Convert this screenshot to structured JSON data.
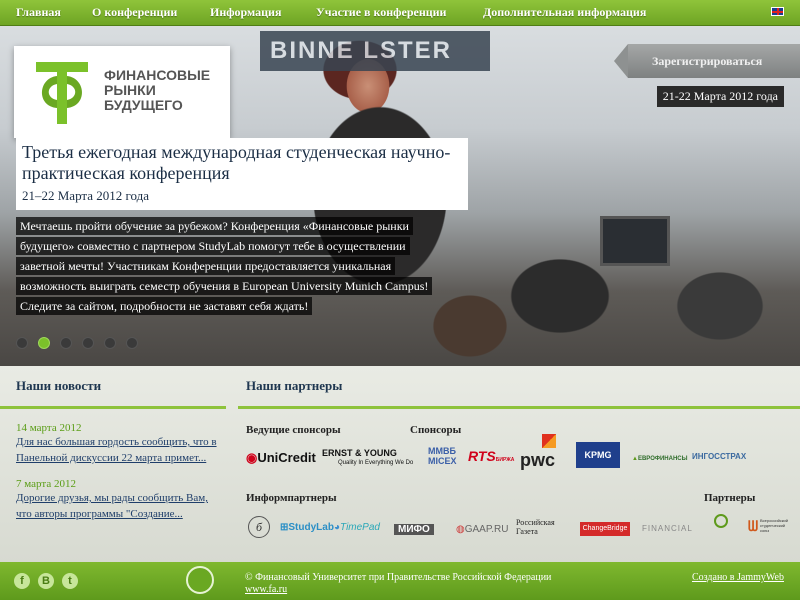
{
  "nav": {
    "items": [
      "Главная",
      "О конференции",
      "Информация",
      "Участие в конференции",
      "Дополнительная информация"
    ],
    "lang_icon": "uk-flag-icon"
  },
  "hero": {
    "sign_text": "BINNE  LSTER",
    "logo_lines": [
      "ФИНАНСОВЫЕ",
      "РЫНКИ",
      "БУДУЩЕГО"
    ],
    "register_label": "Зарегистрироваться",
    "date_badge": "21-22 Марта 2012 года",
    "title": "Третья ежегодная международная студенческая научно-практическая конференция",
    "subtitle_date": "21–22 Марта 2012 года",
    "description": "Мечтаешь пройти обучение за рубежом? Конференция «Финансовые рынки будущего» совместно с партнером StudyLab помогут тебе в осуществлении заветной мечты! Участникам Конференции предоставляется уникальная возможность выиграть семестр обучения в European University Munich Campus! Следите за сайтом, подробности не заставят себя ждать!",
    "slide_count": 6,
    "active_slide": 2
  },
  "news": {
    "title": "Наши новости",
    "items": [
      {
        "date": "14 марта 2012",
        "text": "Для нас большая гордость сообщить, что в Панельной дискуссии 22 марта примет..."
      },
      {
        "date": "7 марта 2012",
        "text": "Дорогие друзья, мы рады сообщить Вам, что авторы программы \"Создание..."
      }
    ]
  },
  "partners": {
    "title": "Наши партнеры",
    "lead_sponsors_label": "Ведущие спонсоры",
    "sponsors_label": "Спонсоры",
    "info_partners_label": "Информпартнеры",
    "partners_label": "Партнеры",
    "lead_sponsors": [
      "UniCredit",
      "ERNST & YOUNG",
      "Quality In Everything We Do"
    ],
    "sponsors": [
      "ММВБ",
      "MICEX",
      "RTS",
      "БИРЖА",
      "pwc",
      "KPMG",
      "ЕВРОФИНАНСЫ",
      "ИНГОССТРАХ"
    ],
    "info_partners": [
      "StudyLab",
      "TimePad",
      "МИФО",
      "GAAP.RU",
      "Российская",
      "Газета",
      "ChangeBridge",
      "FINANCIAL"
    ],
    "partners": [
      "Всероссийский студенческий союз"
    ]
  },
  "footer": {
    "social": [
      "f",
      "B",
      "t"
    ],
    "copyright": "© Финансовый Университет при Правительстве Российской Федерации",
    "url": "www.fa.ru",
    "made_by": "Создано в JammyWeb"
  },
  "colors": {
    "accent": "#7bc12a",
    "nav_green": "#6ea424",
    "title_blue": "#1f3750"
  }
}
